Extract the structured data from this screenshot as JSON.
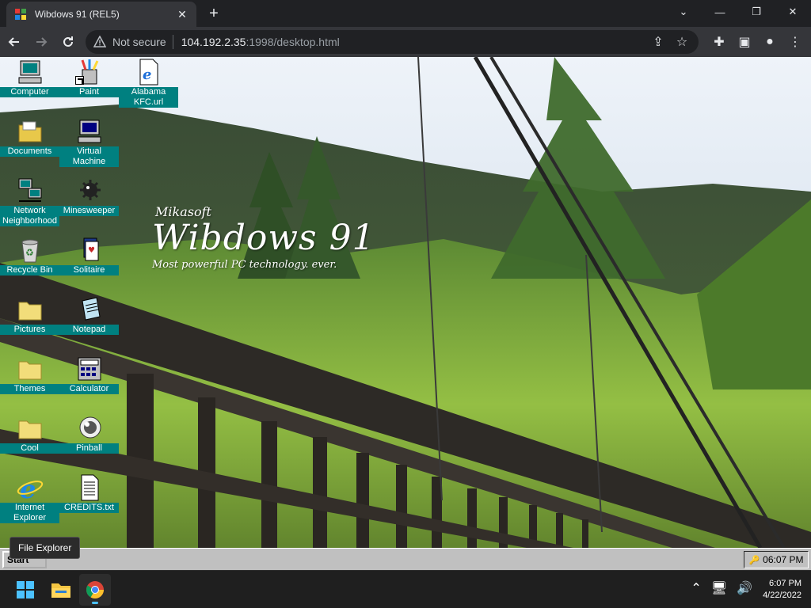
{
  "browser": {
    "tab_title": "Wibdows 91 (REL5)",
    "security_label": "Not secure",
    "url_host": "104.192.2.35",
    "url_path": ":1998/desktop.html"
  },
  "brand": {
    "maker": "Mikasoft",
    "name": "Wibdows 91",
    "tagline": "Most powerful PC technology. ever."
  },
  "desktop_icons": [
    {
      "label": "Computer",
      "icon": "computer-icon"
    },
    {
      "label": "Paint",
      "icon": "paint-icon"
    },
    {
      "label": "Alabama KFC.url",
      "icon": "internet-shortcut-icon"
    },
    {
      "label": "Documents",
      "icon": "folder-open-icon"
    },
    {
      "label": "Virtual Machine",
      "icon": "virtual-machine-icon"
    },
    {
      "label": "Network Neighborhood",
      "icon": "network-icon"
    },
    {
      "label": "Minesweeper",
      "icon": "mine-icon"
    },
    {
      "label": "Recycle Bin",
      "icon": "recycle-bin-icon"
    },
    {
      "label": "Solitaire",
      "icon": "cards-icon"
    },
    {
      "label": "Pictures",
      "icon": "folder-icon"
    },
    {
      "label": "Notepad",
      "icon": "notepad-icon"
    },
    {
      "label": "Themes",
      "icon": "folder-icon"
    },
    {
      "label": "Calculator",
      "icon": "calculator-icon"
    },
    {
      "label": "Cool",
      "icon": "folder-icon"
    },
    {
      "label": "Pinball",
      "icon": "pinball-icon"
    },
    {
      "label": "Internet Explorer",
      "icon": "internet-explorer-icon"
    },
    {
      "label": "CREDITS.txt",
      "icon": "text-file-icon"
    }
  ],
  "tooltip": "File Explorer",
  "w91_taskbar": {
    "start_label": "Start",
    "clock": "06:07 PM"
  },
  "os_taskbar": {
    "time": "6:07 PM",
    "date": "4/22/2022"
  },
  "colors": {
    "icon_label_bg": "#008080",
    "chrome_bg": "#202124",
    "chrome_toolbar": "#35363a"
  }
}
